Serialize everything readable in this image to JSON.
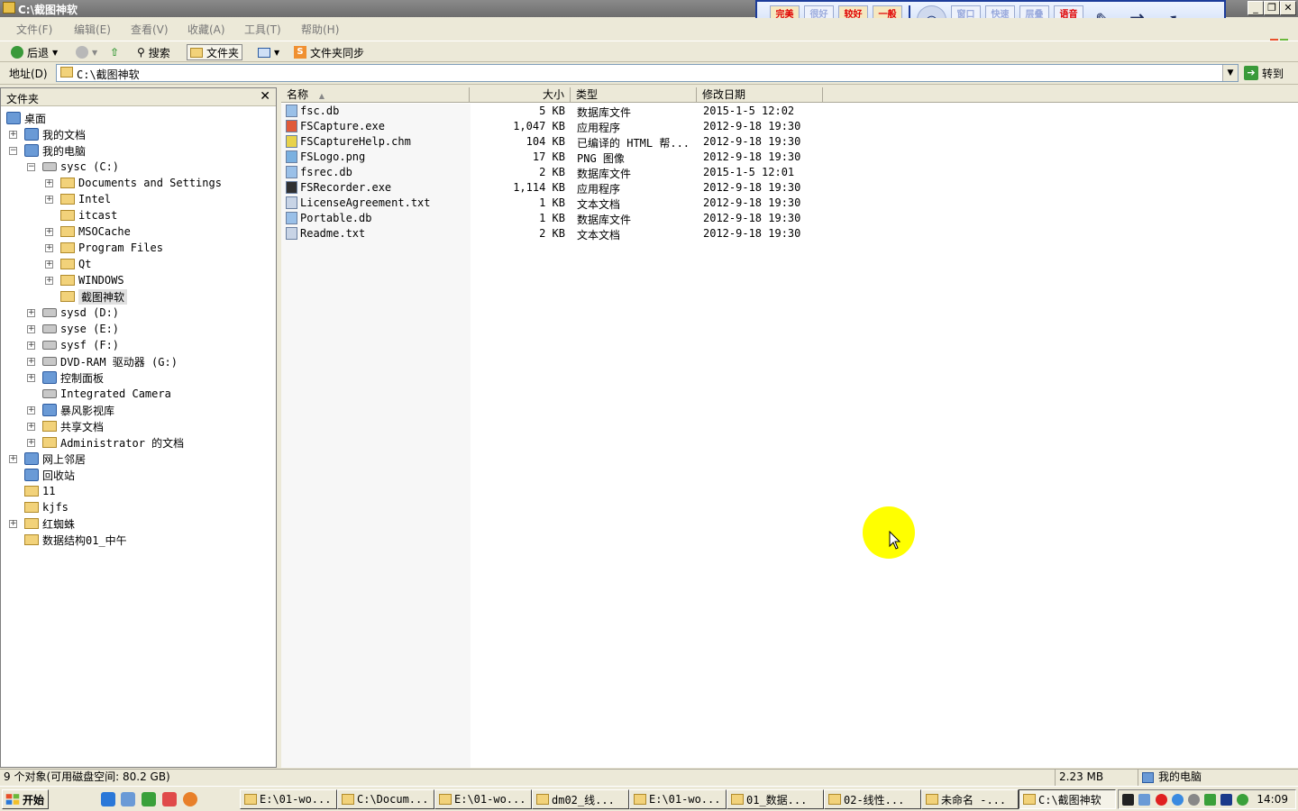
{
  "window": {
    "title": "C:\\截图神软",
    "buttons": [
      "_",
      "❐",
      "✕"
    ]
  },
  "recorder_toolbar": {
    "quality_buttons": [
      "完美\n画质",
      "很好\n画质",
      "较好\n画质",
      "一般\n画质"
    ],
    "mode_buttons": [
      "窗口\n模式",
      "快速\n高效",
      "层叠\n窗口"
    ],
    "voice_button": "语音\n广播"
  },
  "menubar": {
    "items": [
      "文件(F)",
      "编辑(E)",
      "查看(V)",
      "收藏(A)",
      "工具(T)",
      "帮助(H)"
    ]
  },
  "toolbar": {
    "back": "后退",
    "search": "搜索",
    "folders": "文件夹",
    "sync": "文件夹同步"
  },
  "address": {
    "label": "地址(D)",
    "value": "C:\\截图神软",
    "go": "转到"
  },
  "folder_pane": {
    "title": "文件夹",
    "close": "✕",
    "tree": [
      {
        "label": "桌面"
      },
      {
        "label": "我的文档"
      },
      {
        "label": "我的电脑"
      },
      {
        "label": "sysc (C:)"
      },
      {
        "label": "Documents and Settings"
      },
      {
        "label": "Intel"
      },
      {
        "label": "itcast"
      },
      {
        "label": "MSOCache"
      },
      {
        "label": "Program Files"
      },
      {
        "label": "Qt"
      },
      {
        "label": "WINDOWS"
      },
      {
        "label": "截图神软"
      },
      {
        "label": "sysd (D:)"
      },
      {
        "label": "syse (E:)"
      },
      {
        "label": "sysf (F:)"
      },
      {
        "label": "DVD-RAM 驱动器 (G:)"
      },
      {
        "label": "控制面板"
      },
      {
        "label": "Integrated Camera"
      },
      {
        "label": "暴风影视库"
      },
      {
        "label": "共享文档"
      },
      {
        "label": "Administrator 的文档"
      },
      {
        "label": "网上邻居"
      },
      {
        "label": "回收站"
      },
      {
        "label": "11"
      },
      {
        "label": "kjfs"
      },
      {
        "label": "红蜘蛛"
      },
      {
        "label": "数据结构01_中午"
      }
    ]
  },
  "file_list": {
    "columns": [
      "名称",
      "大小",
      "类型",
      "修改日期"
    ],
    "sort_indicator": "▲",
    "rows": [
      {
        "name": "fsc.db",
        "size": "5 KB",
        "type": "数据库文件",
        "date": "2015-1-5 12:02"
      },
      {
        "name": "FSCapture.exe",
        "size": "1,047 KB",
        "type": "应用程序",
        "date": "2012-9-18 19:30"
      },
      {
        "name": "FSCaptureHelp.chm",
        "size": "104 KB",
        "type": "已编译的 HTML 帮...",
        "date": "2012-9-18 19:30"
      },
      {
        "name": "FSLogo.png",
        "size": "17 KB",
        "type": "PNG 图像",
        "date": "2012-9-18 19:30"
      },
      {
        "name": "fsrec.db",
        "size": "2 KB",
        "type": "数据库文件",
        "date": "2015-1-5 12:01"
      },
      {
        "name": "FSRecorder.exe",
        "size": "1,114 KB",
        "type": "应用程序",
        "date": "2012-9-18 19:30"
      },
      {
        "name": "LicenseAgreement.txt",
        "size": "1 KB",
        "type": "文本文档",
        "date": "2012-9-18 19:30"
      },
      {
        "name": "Portable.db",
        "size": "1 KB",
        "type": "数据库文件",
        "date": "2012-9-18 19:30"
      },
      {
        "name": "Readme.txt",
        "size": "2 KB",
        "type": "文本文档",
        "date": "2012-9-18 19:30"
      }
    ]
  },
  "statusbar": {
    "objects": "9 个对象(可用磁盘空间: 80.2 GB)",
    "size": "2.23 MB",
    "location": "我的电脑"
  },
  "taskbar": {
    "start": "开始",
    "tasks": [
      "E:\\01-wo...",
      "C:\\Docum...",
      "E:\\01-wo...",
      "dm02_线...",
      "E:\\01-wo...",
      "01_数据...",
      "02-线性...",
      "未命名 -...",
      "C:\\截图神软"
    ],
    "clock": "14:09"
  }
}
